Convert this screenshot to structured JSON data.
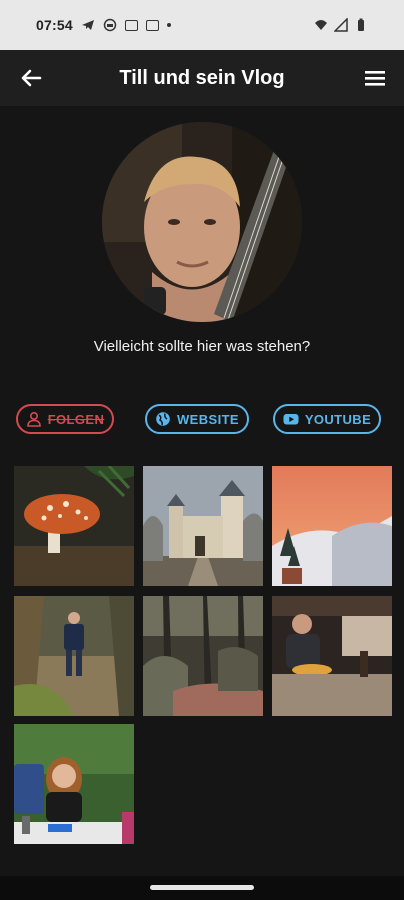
{
  "status_bar": {
    "time": "07:54"
  },
  "app_bar": {
    "title": "Till und sein Vlog"
  },
  "profile": {
    "bio": "Vielleicht sollte hier was stehen?"
  },
  "actions": {
    "follow_label": "FOLGEN",
    "website_label": "WEBSITE",
    "youtube_label": "YOUTUBE"
  },
  "colors": {
    "background": "#151515",
    "app_bar": "#1f1f1f",
    "follow": "#d54a52",
    "accent": "#57b6ec"
  },
  "gallery": [
    {
      "subject": "mushroom-photo"
    },
    {
      "subject": "castle-photo"
    },
    {
      "subject": "snowy-sunset-photo"
    },
    {
      "subject": "forest-walk-photo"
    },
    {
      "subject": "rocky-forest-photo"
    },
    {
      "subject": "kitchen-photo"
    },
    {
      "subject": "garden-portrait-photo"
    }
  ]
}
